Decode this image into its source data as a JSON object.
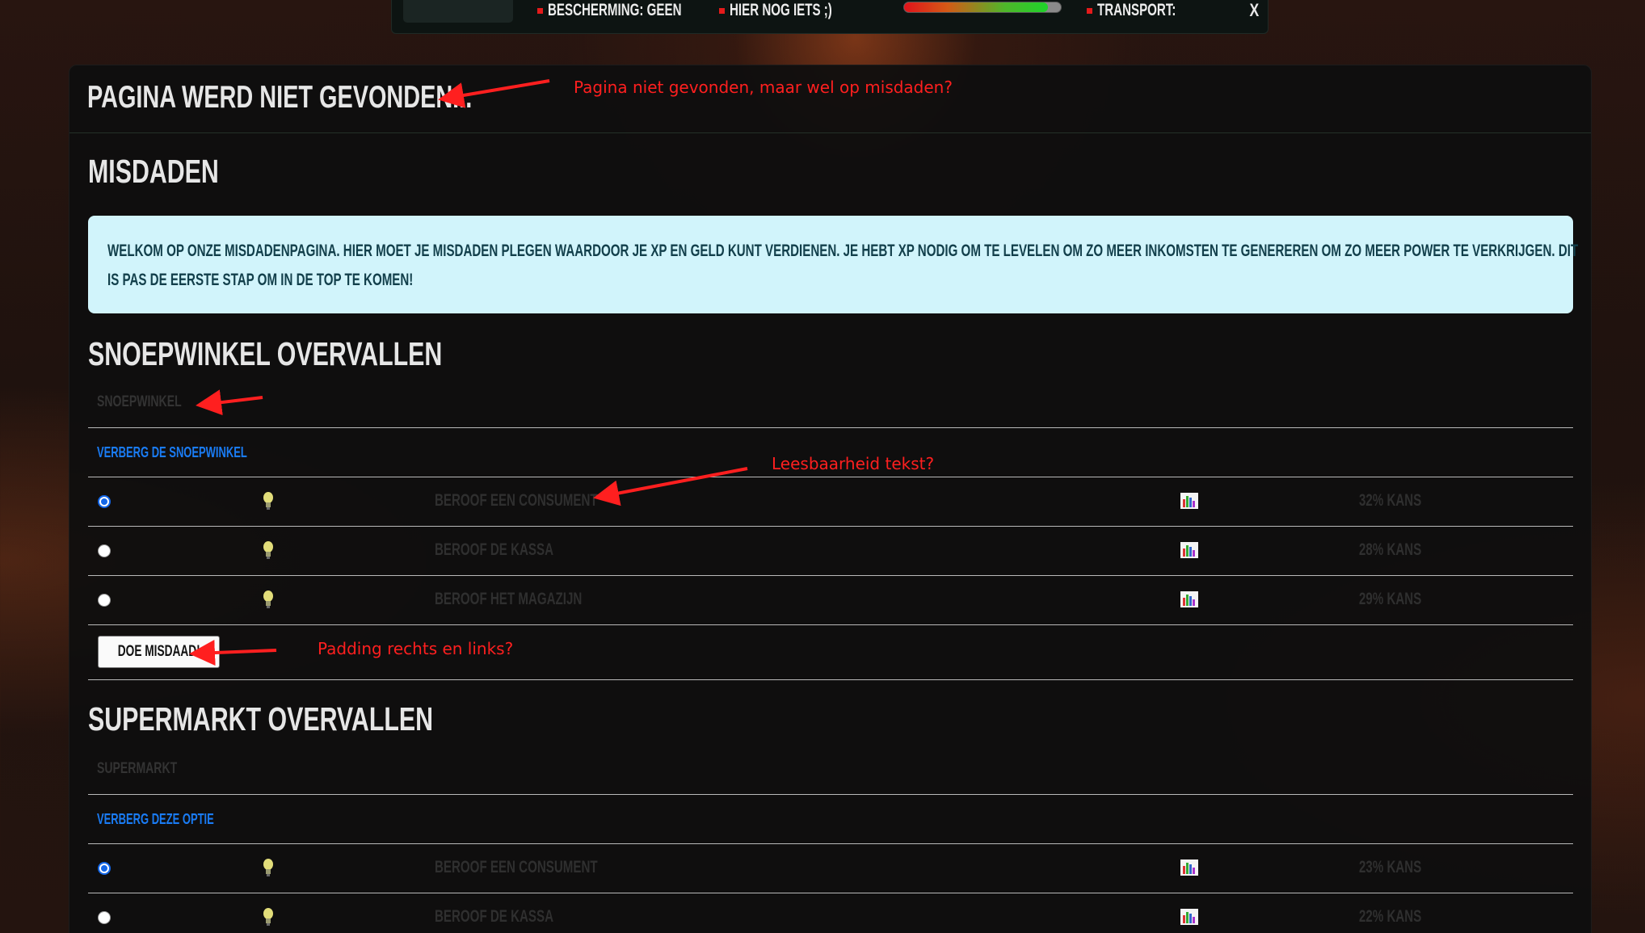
{
  "topbar": {
    "protection_label": "BESCHERMING: GEEN",
    "misc_label": "HIER NOG IETS ;)",
    "health_fraction": 0.92,
    "transport_label": "TRANSPORT:",
    "close_label": "X"
  },
  "panel": {
    "title": "PAGINA WERD NIET GEVONDEN..."
  },
  "crimes": {
    "heading": "MISDADEN",
    "intro": "WELKOM OP ONZE MISDADENPAGINA. HIER MOET JE MISDADEN PLEGEN WAARDOOR JE XP EN GELD KUNT VERDIENEN. JE HEBT XP NODIG OM TE LEVELEN OM ZO MEER INKOMSTEN TE GENEREREN OM ZO MEER POWER TE VERKRIJGEN. DIT IS PAS DE EERSTE STAP OM IN DE TOP TE KOMEN!"
  },
  "snoepwinkel": {
    "heading": "SNOEPWINKEL OVERVALLEN",
    "category": "SNOEPWINKEL",
    "hide_link": "VERBERG DE SNOEPWINKEL",
    "rows": [
      {
        "name": "BEROOF EEN CONSUMENT",
        "chance": "32% KANS",
        "selected": true
      },
      {
        "name": "BEROOF DE KASSA",
        "chance": "28% KANS",
        "selected": false
      },
      {
        "name": "BEROOF HET MAGAZIJN",
        "chance": "29% KANS",
        "selected": false
      }
    ],
    "button": "DOE MISDAAD!"
  },
  "supermarkt": {
    "heading": "SUPERMARKT OVERVALLEN",
    "category": "SUPERMARKT",
    "hide_link": "VERBERG DEZE OPTIE",
    "rows": [
      {
        "name": "BEROOF EEN CONSUMENT",
        "chance": "23% KANS",
        "selected": true
      },
      {
        "name": "BEROOF DE KASSA",
        "chance": "22% KANS",
        "selected": false
      }
    ]
  },
  "annotations": {
    "page_not_found": "Pagina niet gevonden, maar wel op misdaden?",
    "readability": "Leesbaarheid tekst?",
    "padding": "Padding rechts en links?"
  },
  "colors": {
    "accent_link": "#1a7cf5",
    "info_bg": "#d1f4fb",
    "annotation": "#ff1f1f"
  },
  "icons": [
    "bulb-icon",
    "chart-icon",
    "close-icon"
  ]
}
